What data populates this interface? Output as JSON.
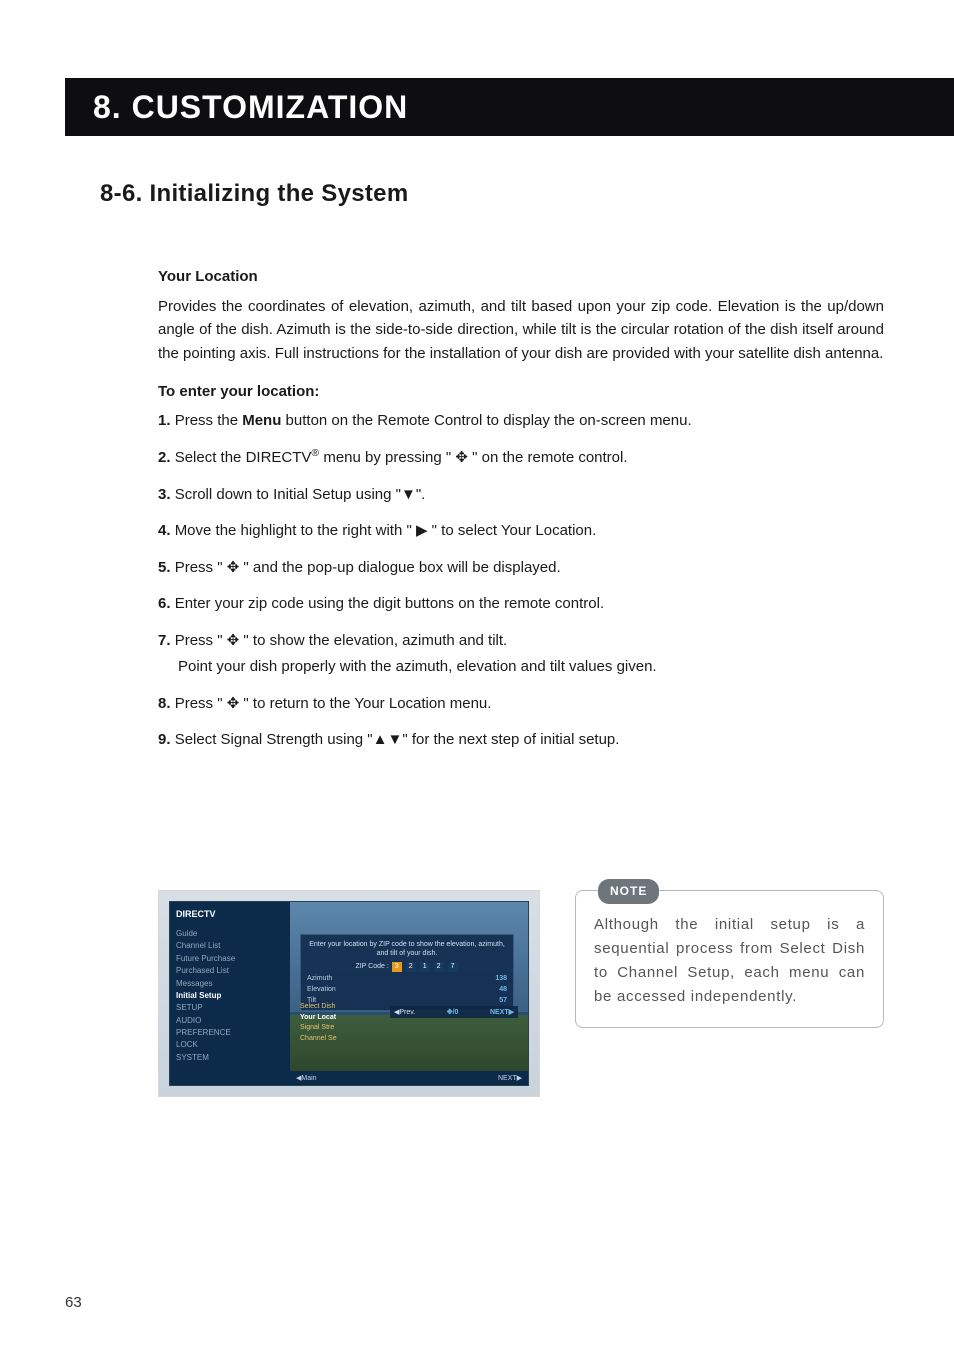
{
  "header": {
    "title": "8. CUSTOMIZATION"
  },
  "section": {
    "title": "8-6. Initializing the System"
  },
  "body": {
    "subheading1": "Your Location",
    "paragraph1": "Provides the coordinates of elevation, azimuth, and tilt based upon your zip code.  Elevation is the up/down angle of the dish.  Azimuth is the side-to-side direction, while tilt is the circular rotation of the dish itself around the pointing axis.  Full instructions for the installation of your dish are provided with your satellite dish antenna.",
    "subheading2": "To enter your location:",
    "steps": [
      {
        "num": "1.",
        "pre": "Press the ",
        "bold": "Menu",
        "post": " button on the Remote Control to display the on-screen menu."
      },
      {
        "num": "2.",
        "pre": "Select the DIRECTV",
        "sup": "®",
        "post": " menu by pressing \" ✥ \" on the remote control."
      },
      {
        "num": "3.",
        "pre": "Scroll down to Initial Setup using \"▼\"."
      },
      {
        "num": "4.",
        "pre": "Move the highlight to the right with \" ▶ \" to select Your Location."
      },
      {
        "num": "5.",
        "pre": "Press \" ✥ \" and the pop-up dialogue box will be displayed."
      },
      {
        "num": "6.",
        "pre": "Enter your zip code using the digit buttons on the remote control."
      },
      {
        "num": "7.",
        "pre": "Press \" ✥ \" to show the elevation, azimuth and tilt.",
        "sub": "Point your dish properly with the azimuth, elevation and tilt values given."
      },
      {
        "num": "8.",
        "pre": "Press \" ✥ \" to return to the Your Location menu."
      },
      {
        "num": "9.",
        "pre": "Select Signal Strength using \"▲▼\" for the next step of initial setup."
      }
    ]
  },
  "figure": {
    "brand": "DIRECTV",
    "sidebar": [
      "Guide",
      "Channel List",
      "Future Purchase",
      "Purchased List",
      "Messages",
      "Initial Setup",
      "SETUP",
      "AUDIO",
      "PREFERENCE",
      "LOCK",
      "SYSTEM"
    ],
    "sidebar_selected": "Initial Setup",
    "box_text": "Enter your location by ZIP code to show the elevation, azimuth, and tilt of your dish.",
    "zip_label": "ZIP Code :",
    "zip_digits": [
      "3",
      "2",
      "1",
      "2",
      "7"
    ],
    "rows": [
      {
        "label": "Azimuth",
        "value": "138"
      },
      {
        "label": "Elevation",
        "value": "48"
      },
      {
        "label": "Tilt",
        "value": "57"
      }
    ],
    "col2": [
      "Select Dish",
      "Your Locat",
      "Signal Stre",
      "Channel Se"
    ],
    "col2_selected": "Your Locat",
    "bar": {
      "prev": "◀Prev.",
      "mid": "✥/0",
      "next": "NEXT▶"
    },
    "footer": {
      "a": "◀Main",
      "b": "NEXT▶"
    }
  },
  "note": {
    "label": "NOTE",
    "text": "Although the initial setup is a sequential process from Select Dish to Channel Setup, each menu can be accessed independently."
  },
  "page_number": "63"
}
